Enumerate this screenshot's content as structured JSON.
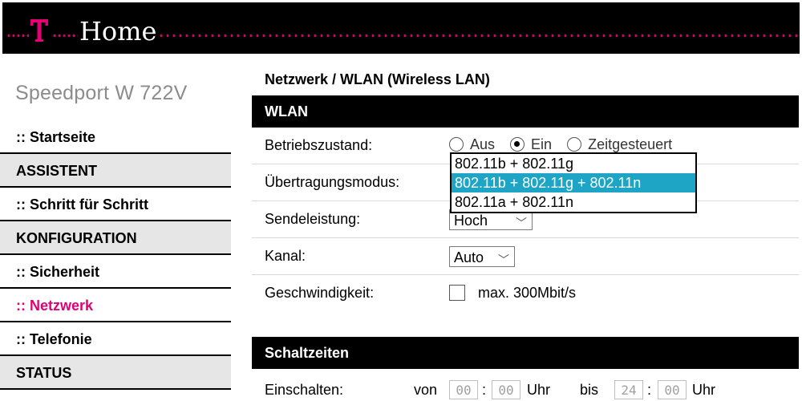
{
  "header": {
    "brand_mark": "T",
    "title": "Home",
    "accent_color": "#e20074"
  },
  "device": {
    "name": "Speedport W 722V"
  },
  "sidebar": {
    "items": [
      {
        "label": ":: Startseite",
        "type": "link"
      },
      {
        "label": "ASSISTENT",
        "type": "section"
      },
      {
        "label": ":: Schritt für Schritt",
        "type": "link"
      },
      {
        "label": "KONFIGURATION",
        "type": "section"
      },
      {
        "label": ":: Sicherheit",
        "type": "link"
      },
      {
        "label": ":: Netzwerk",
        "type": "link",
        "active": true
      },
      {
        "label": ":: Telefonie",
        "type": "link"
      },
      {
        "label": "STATUS",
        "type": "section"
      }
    ]
  },
  "main": {
    "breadcrumb": "Netzwerk / WLAN (Wireless LAN)",
    "wlan": {
      "title": "WLAN",
      "betriebszustand": {
        "label": "Betriebszustand:",
        "options": [
          "Aus",
          "Ein",
          "Zeitgesteuert"
        ],
        "selected": "Ein"
      },
      "uebertragungsmodus": {
        "label": "Übertragungsmodus:",
        "options": [
          "802.11b + 802.11g",
          "802.11b + 802.11g + 802.11n",
          "802.11a + 802.11n"
        ],
        "highlighted": "802.11b + 802.11g + 802.11n"
      },
      "sendeleistung": {
        "label": "Sendeleistung:",
        "value": "Hoch"
      },
      "kanal": {
        "label": "Kanal:",
        "value": "Auto"
      },
      "geschwindigkeit": {
        "label": "Geschwindigkeit:",
        "checkbox_label": "max. 300Mbit/s",
        "checked": false
      }
    },
    "schaltzeiten": {
      "title": "Schaltzeiten",
      "einschalten": {
        "label": "Einschalten:",
        "von_label": "von",
        "von_h": "00",
        "von_m": "00",
        "uhr1": "Uhr",
        "bis_label": "bis",
        "bis_h": "24",
        "bis_m": "00",
        "uhr2": "Uhr",
        "separator": ":"
      }
    }
  },
  "icons": {
    "chevron": "chevron-down-icon"
  }
}
